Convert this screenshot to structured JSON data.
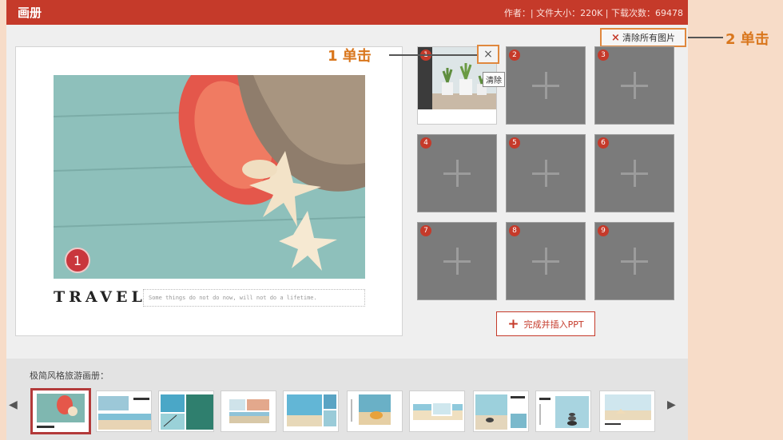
{
  "window": {
    "title": "画册",
    "meta": "作者：| 文件大小：220K | 下载次数：69478"
  },
  "toolbar": {
    "clear_all_label": "清除所有图片",
    "clear_icon": "×"
  },
  "preview": {
    "badge": "1",
    "heading": "TRAVEL",
    "caption": "Some things do not do now, will not do a lifetime."
  },
  "slots": [
    {
      "number": "1",
      "filled": true
    },
    {
      "number": "2",
      "filled": false
    },
    {
      "number": "3",
      "filled": false
    },
    {
      "number": "4",
      "filled": false
    },
    {
      "number": "5",
      "filled": false
    },
    {
      "number": "6",
      "filled": false
    },
    {
      "number": "7",
      "filled": false
    },
    {
      "number": "8",
      "filled": false
    },
    {
      "number": "9",
      "filled": false
    }
  ],
  "slot_remove": {
    "icon": "×",
    "tooltip": "清除"
  },
  "finish_button": {
    "icon": "+",
    "label": "完成并插入PPT"
  },
  "templates": {
    "title": "极简风格旅游画册：",
    "prev_icon": "◀",
    "next_icon": "▶",
    "count": 10,
    "selected_index": 0
  },
  "annotations": {
    "step1": "1 单击",
    "step2": "2 单击"
  },
  "colors": {
    "brand": "#c53a2a",
    "highlight": "#e0883e",
    "callout": "#d9761c"
  }
}
